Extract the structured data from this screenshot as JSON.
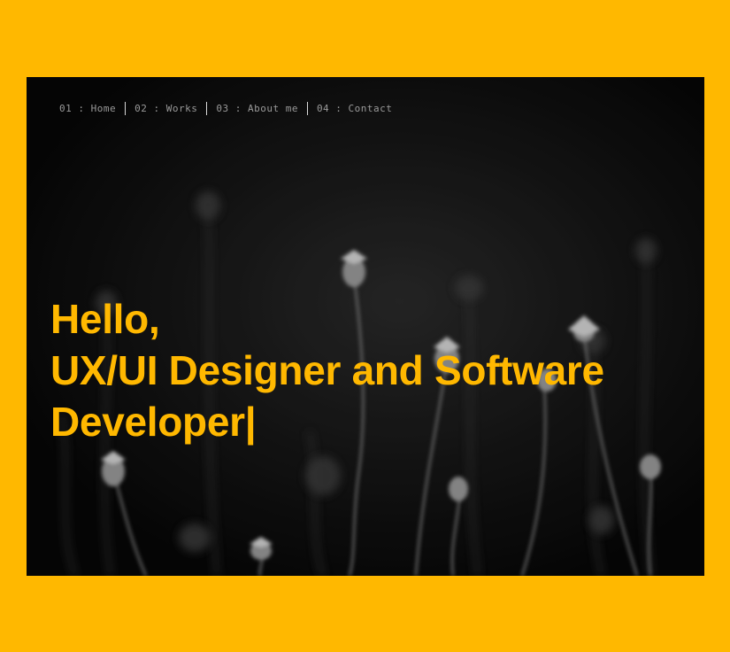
{
  "colors": {
    "frame": "#FFB800",
    "hero_background": "#0b0b0b",
    "headline": "#FFB800",
    "nav_text": "#9a9a9a",
    "nav_separator": "#d9d9d9"
  },
  "nav": {
    "items": [
      {
        "label": "01 : Home"
      },
      {
        "label": "02 : Works"
      },
      {
        "label": "03 : About me"
      },
      {
        "label": "04 : Contact"
      }
    ]
  },
  "hero": {
    "background_image": "black-and-white-wildflowers-photo",
    "headline": {
      "line1": "Hello,",
      "line2": "UX/UI Designer and Software",
      "line3": "Developer|"
    }
  }
}
